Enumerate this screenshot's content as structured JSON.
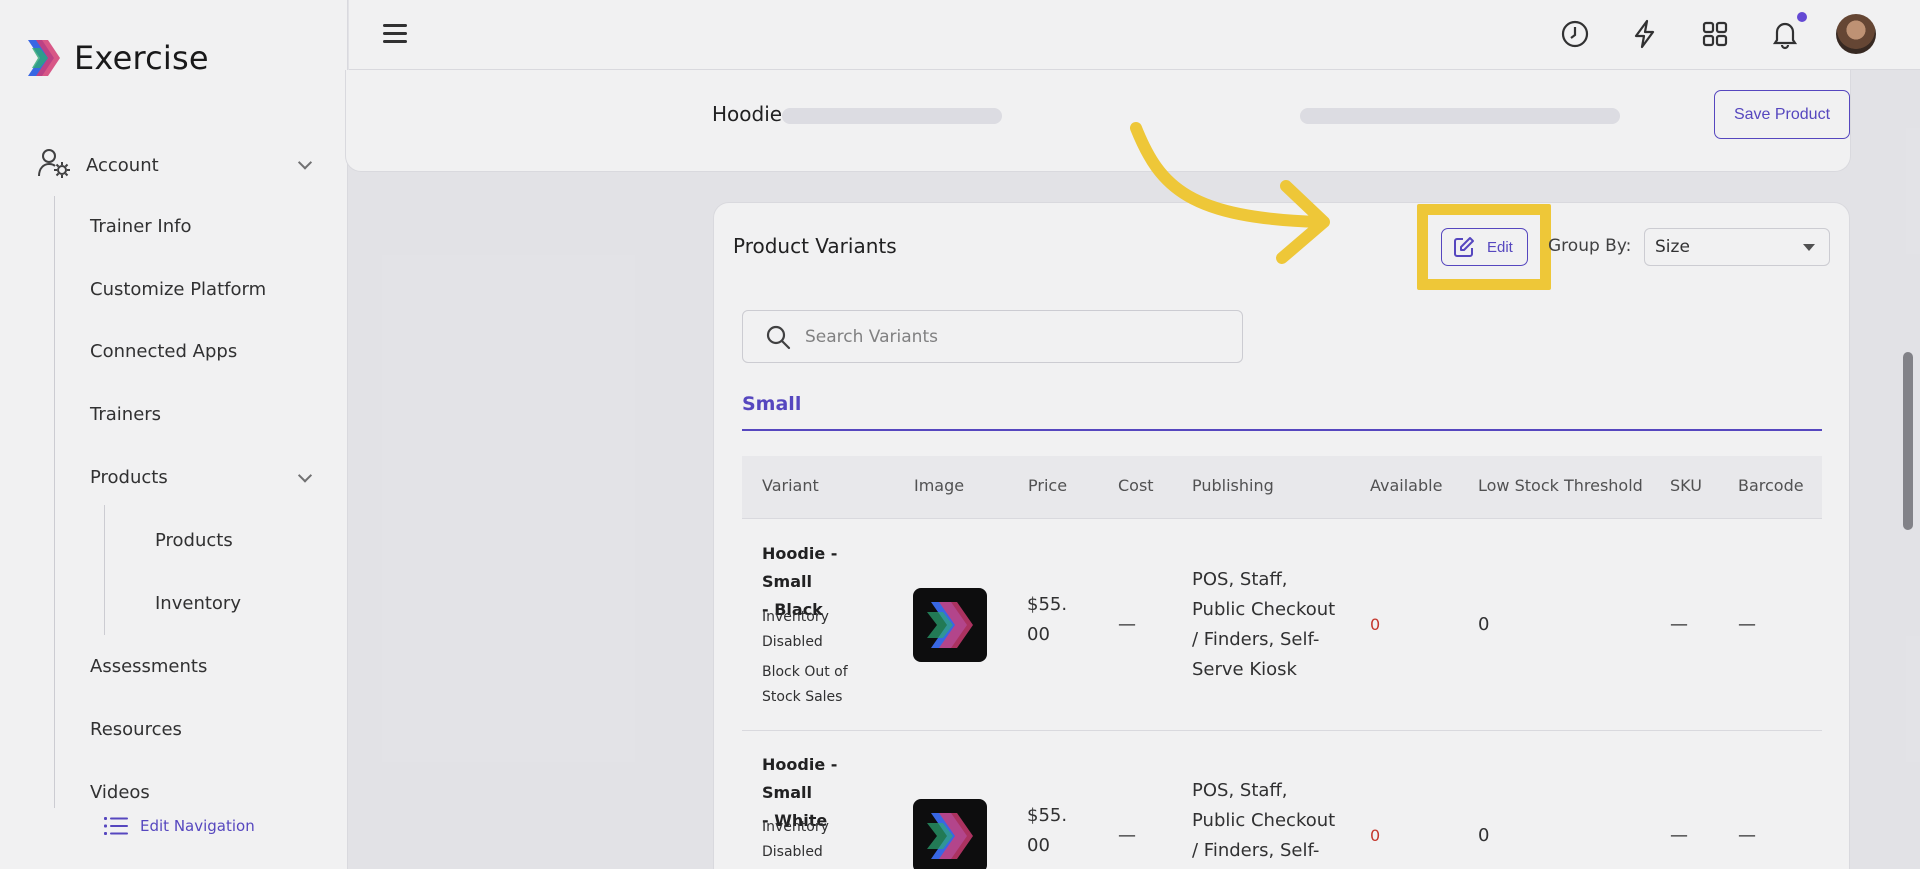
{
  "brand": {
    "title": "Exercise"
  },
  "sidebar": {
    "account_label": "Account",
    "items": [
      {
        "label": "Trainer Info"
      },
      {
        "label": "Customize Platform"
      },
      {
        "label": "Connected Apps"
      },
      {
        "label": "Trainers"
      },
      {
        "label": "Products"
      },
      {
        "label": "Assessments"
      },
      {
        "label": "Resources"
      },
      {
        "label": "Videos"
      }
    ],
    "products_sub": [
      {
        "label": "Products"
      },
      {
        "label": "Inventory"
      }
    ],
    "edit_navigation": "Edit Navigation"
  },
  "topbar": {
    "icons": [
      "history-icon",
      "lightning-icon",
      "apps-grid-icon",
      "bell-icon"
    ]
  },
  "product": {
    "title": "Hoodie",
    "save_label": "Save Product"
  },
  "variants": {
    "title": "Product Variants",
    "edit_label": "Edit",
    "group_by_label": "Group By:",
    "group_by_value": "Size",
    "search_placeholder": "Search Variants",
    "tab": "Small",
    "columns": [
      "Variant",
      "Image",
      "Price",
      "Cost",
      "Publishing",
      "Available",
      "Low Stock Threshold",
      "SKU",
      "Barcode"
    ],
    "rows": [
      {
        "name_line1": "Hoodie - Small",
        "name_line2": "- Black",
        "note1": "Inventory",
        "note2": "Disabled",
        "note3": "Block Out of",
        "note4": "Stock Sales",
        "price_line1": "$55.",
        "price_line2": "00",
        "cost": "—",
        "pub1": "POS, Staff,",
        "pub2": "Public Checkout",
        "pub3": "/ Finders, Self-",
        "pub4": "Serve Kiosk",
        "available": "0",
        "threshold": "0",
        "sku": "—",
        "barcode": "—"
      },
      {
        "name_line1": "Hoodie - Small",
        "name_line2": "- White",
        "note1": "Inventory",
        "note2": "Disabled",
        "price_line1": "$55.",
        "price_line2": "00",
        "cost": "—",
        "pub1": "POS, Staff,",
        "pub2": "Public Checkout",
        "pub3": "/ Finders, Self-",
        "available": "0",
        "threshold": "0",
        "sku": "—",
        "barcode": "—"
      }
    ]
  },
  "colors": {
    "accent": "#5b4bc9",
    "highlight": "#fcd33a",
    "alert_red": "#d03a2e"
  }
}
